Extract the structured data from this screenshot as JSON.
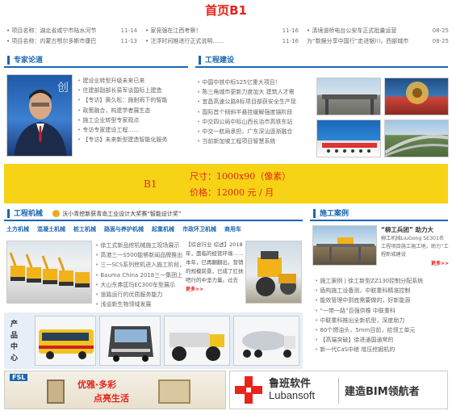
{
  "page": {
    "title": "首页B1"
  },
  "top_news": {
    "col1": [
      {
        "text": "项目名称：湖北省咸宁市陆水河节",
        "date": "11-14"
      },
      {
        "text": "项目名称：内蒙古鄂尔多斯市康巴",
        "date": "11-13"
      }
    ],
    "col2": [
      {
        "text": "• 家竞强在江西考察！",
        "date": "11-16"
      },
      {
        "text": "• 注浮时间推进行正式说明……",
        "date": "11-16"
      }
    ],
    "col3": [
      {
        "text": "• 清境道桥电台公安车正式批量运营",
        "date": "08-25"
      },
      {
        "text": "为“数据分享中国行”走进银川，西部城市",
        "date": "08-25"
      }
    ]
  },
  "expert": {
    "title": "专家论道",
    "items": [
      "建设业转型升级未来已来",
      "住建部副部长易军谈国际上建造",
      "【专访】黄久松：施耐雨下的智能",
      "政策融合，构建学者展生态",
      "施工企业转型专家观点",
      "专访专家建设工程……",
      "【专访】未来新型建造智能化服务"
    ]
  },
  "engineering": {
    "title": "工程建设",
    "items": [
      "中国中铁中标S25亿重大项目！",
      "陈三角城市更新力度加大 建筑人才需",
      "宜昌高速公路8标项目部获安全生产现",
      "国际首个倾斜半悬挂缓解强度锚阶段",
      "中交四公局中标山西长治市高铁东站",
      "中交一航局承担，广东深汕逐渐融合",
      "当前新加坡工程项目智慧系统"
    ]
  },
  "ad_b1": {
    "label": "B1",
    "size": "尺寸：1000x90（像素）",
    "price": "价格：12000 元 / 月"
  },
  "machinery": {
    "title": "工程机械",
    "banner": "沃小青挖新获青岛工业设计大奖赛“智能设计奖”",
    "categories": [
      "土方机械",
      "混凝土机械",
      "桩工机械",
      "路面与养护机械",
      "起重机械",
      "市政环卫机械",
      "商用车"
    ],
    "items": [
      "徐工式新品挖机械施工现场展示",
      "高港三一S500能够新闻品牌推出",
      "三一SCS系列挖机进入施工阶段，",
      "Bauma China 2018三一集团上演",
      "大山东弗匡玛EC300车型展示",
      "道路运行的优质服务能力",
      "浅谈新生物领域发展"
    ],
    "review": "【综合行业 综述】2018年，面临的经营环境……本年，已再翻翻出，营销的规模前景，已成了扛扶吧行的中坚力量。过去",
    "more": "更多>>"
  },
  "cases": {
    "title": "施工案例",
    "feature_title": "“柳工兵团” 助力大",
    "feature_text": "柳工机械LiuGong SE301名工程项目施工施工地，助力“工程新城建设",
    "more": "更多>>",
    "items": [
      "施工案例 | 徐工新型ZZ130控制分配系统",
      "盾构施工设备测，中联重科精准控制",
      "能效管理中到底需要做的，好新能源",
      "“一带一路”百强供橡 中联重科",
      "中联重科推出全新机型，深度助力",
      "80个燃油头，5mm目前，给领工单元",
      "【高端突破】徐进通国通常的",
      "新一代CaS中继 增压挖掘机的"
    ]
  },
  "product_center": {
    "label": "产品中心"
  },
  "bottom_ads": {
    "left_brand": "FSL",
    "left_slogan1": "优雅·多彩",
    "left_slogan2": "点亮生活",
    "right_brand_cn": "鲁班软件",
    "right_brand_en": "Lubansoft",
    "right_slogan": "建造BIM领航者"
  },
  "colors": {
    "accent_blue": "#1b66b2",
    "accent_red": "#e8241c",
    "ad_yellow": "#f6d315"
  }
}
